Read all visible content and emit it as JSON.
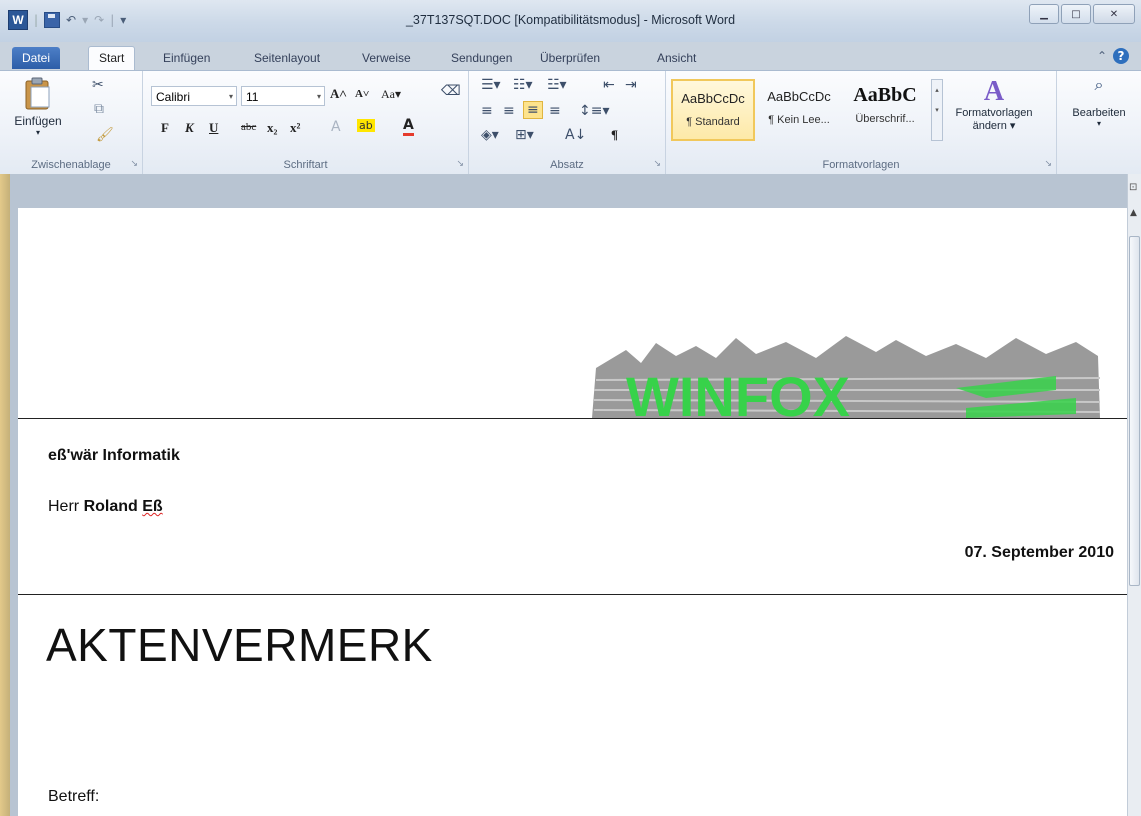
{
  "window": {
    "title": "_37T137SQT.DOC [Kompatibilitätsmodus] - Microsoft Word",
    "app_icon": "word-icon",
    "quick_access": [
      "save-icon",
      "undo-icon",
      "redo-icon",
      "customize-icon"
    ],
    "minimize_icon": "minimize-icon",
    "maximize_icon": "maximize-icon",
    "close_label": "✕"
  },
  "tabs": {
    "file": "Datei",
    "start": "Start",
    "insert": "Einfügen",
    "layout": "Seitenlayout",
    "references": "Verweise",
    "mailings": "Sendungen",
    "review": "Überprüfen",
    "view": "Ansicht"
  },
  "ribbon": {
    "clipboard": {
      "label": "Zwischenablage",
      "paste": "Einfügen"
    },
    "font": {
      "label": "Schriftart",
      "family": "Calibri",
      "size": "11",
      "bold": "F",
      "italic": "K",
      "underline": "U",
      "strike": "abc",
      "case": "Aa"
    },
    "paragraph": {
      "label": "Absatz",
      "pilcrow": "¶"
    },
    "styles": {
      "label": "Formatvorlagen",
      "items": [
        {
          "sample": "AaBbCcDc",
          "name": "¶ Standard"
        },
        {
          "sample": "AaBbCcDc",
          "name": "¶ Kein Lee..."
        },
        {
          "sample": "AaBbC",
          "name": "Überschrif..."
        }
      ],
      "change_line1": "Formatvorlagen",
      "change_line2": "ändern ▾"
    },
    "edit": {
      "label": "Bearbeiten"
    }
  },
  "document": {
    "logo_text": "WINFOX",
    "company": "eß'wär Informatik",
    "salutation": "Herr",
    "first_name": "Roland",
    "last_name": "Eß",
    "date": "07. September 2010",
    "heading": "AKTENVERMERK",
    "subject_label": "Betreff:"
  },
  "colors": {
    "logo_green": "#37d24a",
    "accent": "#2b5797"
  }
}
